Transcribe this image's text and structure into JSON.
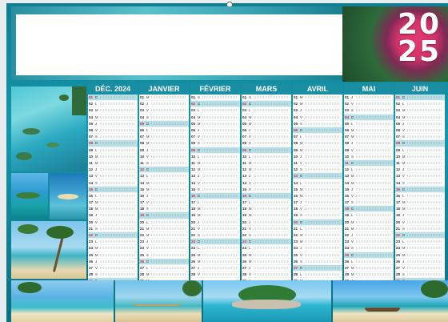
{
  "year_top": "20",
  "year_bottom": "25",
  "months": [
    {
      "label": "DÉC. 2024",
      "days": 31,
      "start": 0
    },
    {
      "label": "JANVIER",
      "days": 31,
      "start": 3
    },
    {
      "label": "FÉVRIER",
      "days": 28,
      "start": 6
    },
    {
      "label": "MARS",
      "days": 31,
      "start": 6
    },
    {
      "label": "AVRIL",
      "days": 30,
      "start": 2
    },
    {
      "label": "MAI",
      "days": 31,
      "start": 4
    },
    {
      "label": "JUIN",
      "days": 30,
      "start": 0
    }
  ],
  "weekday_letters": [
    "D",
    "L",
    "M",
    "M",
    "J",
    "V",
    "S"
  ],
  "colors": {
    "teal": "#1a8fa4",
    "sunday": "#b7dfe6",
    "red": "#d8233c"
  }
}
